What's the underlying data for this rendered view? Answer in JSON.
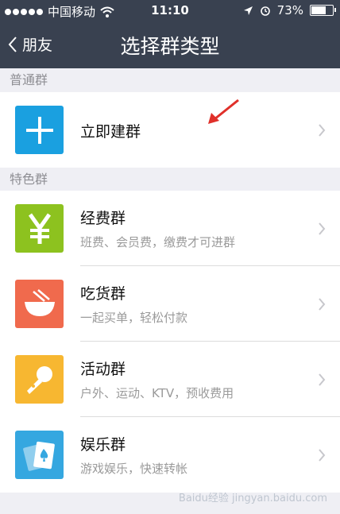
{
  "status_bar": {
    "carrier": "中国移动",
    "time": "11:10",
    "battery": "73%",
    "battery_level": 0.73
  },
  "nav": {
    "back_label": "朋友",
    "title": "选择群类型"
  },
  "sections": [
    {
      "header": "普通群",
      "items": [
        {
          "name": "立即建群",
          "desc": "",
          "icon": "plus-icon",
          "color": "#1aa0e0"
        }
      ]
    },
    {
      "header": "特色群",
      "items": [
        {
          "name": "经费群",
          "desc": "班费、会员费，缴费才可进群",
          "icon": "yen-icon",
          "color": "#8dc21f"
        },
        {
          "name": "吃货群",
          "desc": "一起买单，轻松付款",
          "icon": "bowl-icon",
          "color": "#f06a4d"
        },
        {
          "name": "活动群",
          "desc": "户外、运动、KTV，预收费用",
          "icon": "microphone-icon",
          "color": "#f7b731"
        },
        {
          "name": "娱乐群",
          "desc": "游戏娱乐，快速转帐",
          "icon": "playing-card-icon",
          "color": "#35a7e0"
        }
      ]
    }
  ],
  "annotation_color": "#e0302a",
  "watermark": "Baidu经验 jingyan.baidu.com"
}
